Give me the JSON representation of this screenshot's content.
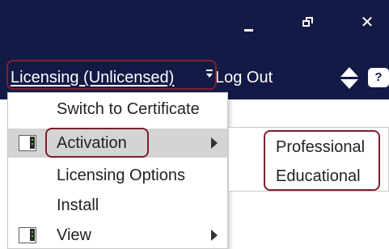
{
  "window": {
    "minimize_icon": "minimize-icon",
    "restore_icon": "restore-icon",
    "close_icon": "close-icon",
    "close_glyph": "✕"
  },
  "menubar": {
    "licensing_label": "Licensing (Unlicensed)",
    "logout_label": "Log Out",
    "sort_icon": "sort-updown-icon",
    "help_glyph": "?"
  },
  "dropdown": {
    "items": [
      {
        "label": "Switch to Certificate",
        "icon": null,
        "submenu": false
      },
      {
        "label": "Activation",
        "icon": "panel-icon",
        "submenu": true,
        "highlighted": true
      },
      {
        "label": "Licensing Options",
        "icon": null,
        "submenu": false
      },
      {
        "label": "Install",
        "icon": null,
        "submenu": false
      },
      {
        "label": "View",
        "icon": "panel-icon",
        "submenu": true
      }
    ]
  },
  "submenu": {
    "items": [
      {
        "label": "Professional"
      },
      {
        "label": "Educational"
      }
    ]
  },
  "colors": {
    "header_bg": "#141a46",
    "highlight_outline": "#7d1f30",
    "active_item_bg": "#d4d4d4"
  }
}
